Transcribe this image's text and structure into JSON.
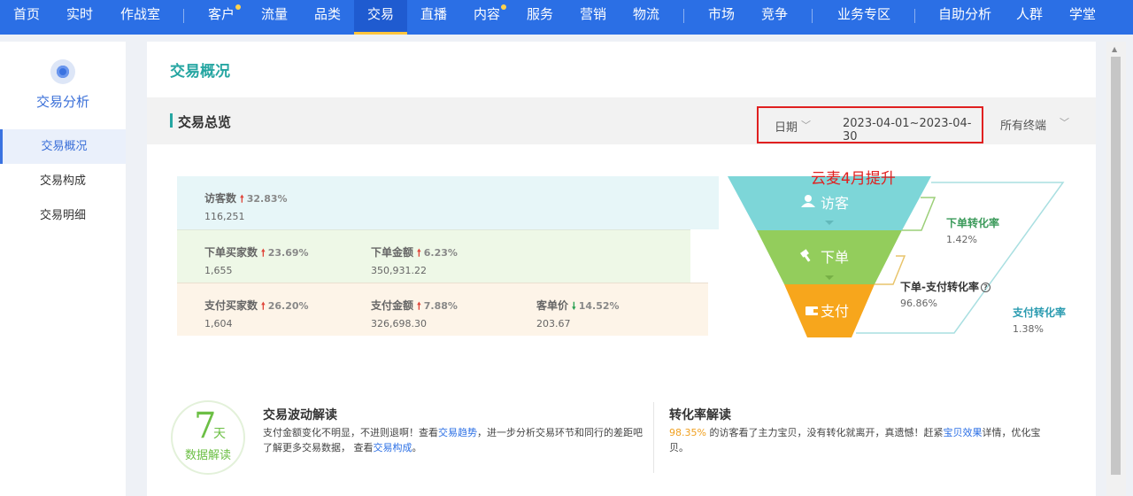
{
  "nav": {
    "items": [
      "首页",
      "实时",
      "作战室",
      "客户",
      "流量",
      "品类",
      "交易",
      "直播",
      "内容",
      "服务",
      "营销",
      "物流",
      "市场",
      "竞争",
      "业务专区",
      "自助分析",
      "人群",
      "学堂"
    ],
    "active_index": 6
  },
  "sidebar": {
    "title": "交易分析",
    "items": [
      "交易概况",
      "交易构成",
      "交易明细"
    ]
  },
  "page": {
    "title": "交易概况"
  },
  "overview": {
    "section_title": "交易总览",
    "date_label": "日期",
    "date_range": "2023-04-01~2023-04-30",
    "terminal": "所有终端"
  },
  "stats": {
    "visitors": {
      "label": "访客数",
      "pct": "32.83%",
      "value": "116,251",
      "trend": "up"
    },
    "order_buyers": {
      "label": "下单买家数",
      "pct": "23.69%",
      "value": "1,655",
      "trend": "up"
    },
    "order_amount": {
      "label": "下单金额",
      "pct": "6.23%",
      "value": "350,931.22",
      "trend": "up"
    },
    "pay_buyers": {
      "label": "支付买家数",
      "pct": "26.20%",
      "value": "1,604",
      "trend": "up"
    },
    "pay_amount": {
      "label": "支付金额",
      "pct": "7.88%",
      "value": "326,698.30",
      "trend": "up"
    },
    "avg_price": {
      "label": "客单价",
      "pct": "14.52%",
      "value": "203.67",
      "trend": "down"
    }
  },
  "funnel": {
    "annotation": "云麦4月提升",
    "stages": [
      "访客",
      "下单",
      "支付"
    ],
    "colors": {
      "visitor": "#7dd6d8",
      "order": "#93cd5c",
      "pay": "#f7a61c"
    },
    "rates": {
      "order_conv": {
        "label": "下单转化率",
        "value": "1.42%"
      },
      "order_pay_conv": {
        "label": "下单-支付转化率",
        "value": "96.86%"
      },
      "pay_conv": {
        "label": "支付转化率",
        "value": "1.38%"
      }
    }
  },
  "interpretation": {
    "badge_number": "7",
    "badge_unit": "天",
    "badge_caption": "数据解读",
    "trade": {
      "title": "交易波动解读",
      "text1": "支付金额变化不明显，不进则退啊！查看",
      "link1": "交易趋势",
      "text2": "，进一步分析交易环节和同行的差距吧",
      "text3": "了解更多交易数据，  查看",
      "link2": "交易构成",
      "text4": "。"
    },
    "conversion": {
      "title": "转化率解读",
      "highlight": "98.35%",
      "text1": "的访客看了主力宝贝，没有转化就离开，真遗憾！赶紧",
      "link": "宝贝效果",
      "text2": "详情，优化宝",
      "text3": "贝。"
    }
  }
}
